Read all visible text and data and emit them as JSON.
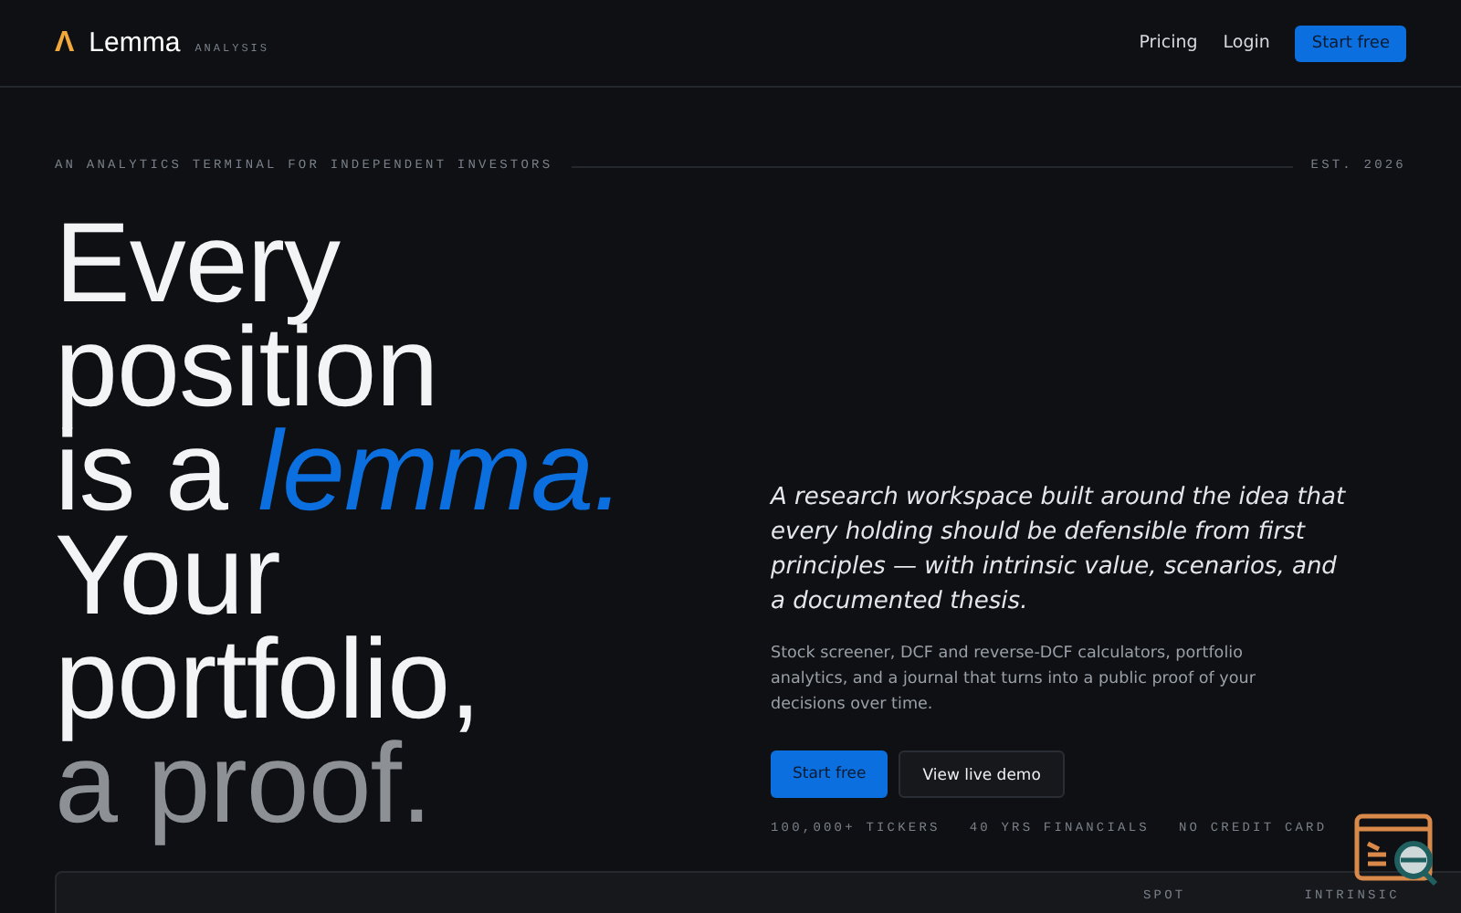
{
  "nav": {
    "logo_mark": "Λ",
    "brand": "Lemma",
    "tagline": "ANALYSIS",
    "links": [
      "Pricing",
      "Login"
    ],
    "cta": "Start free"
  },
  "eyebrow": {
    "left": "AN ANALYTICS TERMINAL FOR INDEPENDENT INVESTORS",
    "right": "EST. 2026"
  },
  "headline": [
    [
      {
        "text": "Every",
        "kind": "plain"
      }
    ],
    [
      {
        "text": "position",
        "kind": "plain"
      }
    ],
    [
      {
        "text": "is a ",
        "kind": "plain"
      },
      {
        "text": "lemma.",
        "kind": "accent"
      }
    ],
    [
      {
        "text": "Your",
        "kind": "plain"
      }
    ],
    [
      {
        "text": "portfolio,",
        "kind": "plain"
      }
    ],
    [
      {
        "text": "a proof.",
        "kind": "muted"
      }
    ]
  ],
  "lead": "A research workspace built around the idea that every holding should be defensible from first principles — with intrinsic value, scenarios, and a documented thesis.",
  "body": "Stock screener, DCF and reverse-DCF calculators, portfolio analytics, and a journal that turns into a public proof of your decisions over time.",
  "buttons": [
    {
      "label": "Start free",
      "kind": "primary"
    },
    {
      "label": "View live demo",
      "kind": "secondary"
    }
  ],
  "facts": [
    "100,000+ TICKERS",
    "40 YRS FINANCIALS",
    "NO CREDIT CARD"
  ],
  "table": {
    "columns": [
      "SPOT",
      "INTRINSIC"
    ]
  }
}
